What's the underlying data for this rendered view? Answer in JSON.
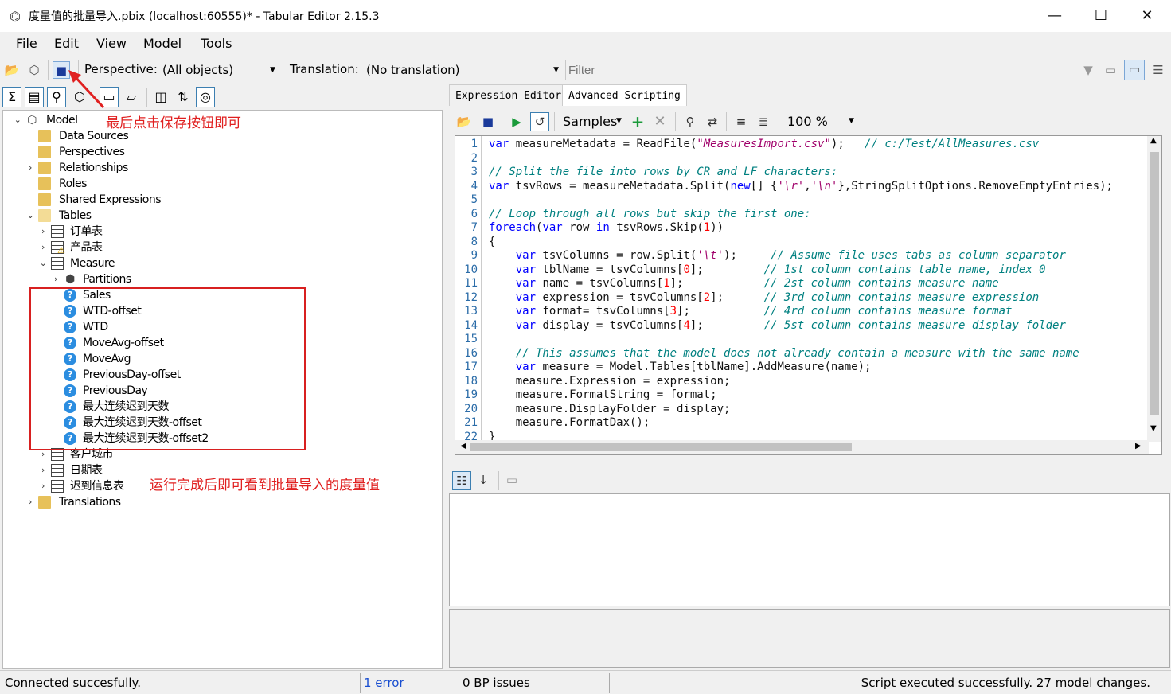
{
  "window": {
    "title": "度量值的批量导入.pbix (localhost:60555)* - Tabular Editor 2.15.3",
    "minimize": "—",
    "maximize": "☐",
    "close": "✕"
  },
  "menu": [
    "File",
    "Edit",
    "View",
    "Model",
    "Tools"
  ],
  "toolbar": {
    "perspective_label": "Perspective:",
    "perspective_value": "(All objects)",
    "translation_label": "Translation:",
    "translation_value": "(No translation)",
    "filter_placeholder": "Filter"
  },
  "tree": {
    "model": "Model",
    "items": {
      "data_sources": "Data Sources",
      "perspectives": "Perspectives",
      "relationships": "Relationships",
      "roles": "Roles",
      "shared_expressions": "Shared Expressions",
      "tables": "Tables",
      "t_orders": "订单表",
      "t_products": "产品表",
      "t_measure": "Measure",
      "partitions": "Partitions",
      "m1": "Sales",
      "m2": "WTD-offset",
      "m3": "WTD",
      "m4": "MoveAvg-offset",
      "m5": "MoveAvg",
      "m6": "PreviousDay-offset",
      "m7": "PreviousDay",
      "m8": "最大连续迟到天数",
      "m9": "最大连续迟到天数-offset",
      "m10": "最大连续迟到天数-offset2",
      "t_city": "客户城市",
      "t_date": "日期表",
      "t_late": "迟到信息表",
      "translations": "Translations"
    }
  },
  "annotations": {
    "save_hint": "最后点击保存按钮即可",
    "result_hint": "运行完成后即可看到批量导入的度量值"
  },
  "tabs": {
    "expression_editor": "Expression Editor",
    "advanced_scripting": "Advanced Scripting"
  },
  "editor_toolbar": {
    "samples": "Samples",
    "zoom": "100 %"
  },
  "code_line_numbers": [
    "1",
    "2",
    "3",
    "4",
    "5",
    "6",
    "7",
    "8",
    "9",
    "10",
    "11",
    "12",
    "13",
    "14",
    "15",
    "16",
    "17",
    "18",
    "19",
    "20",
    "21",
    "22"
  ],
  "status": {
    "left": "Connected succesfully.",
    "errors": "1 error",
    "bp": "0 BP issues",
    "right": "Script executed successfully. 27 model changes."
  }
}
